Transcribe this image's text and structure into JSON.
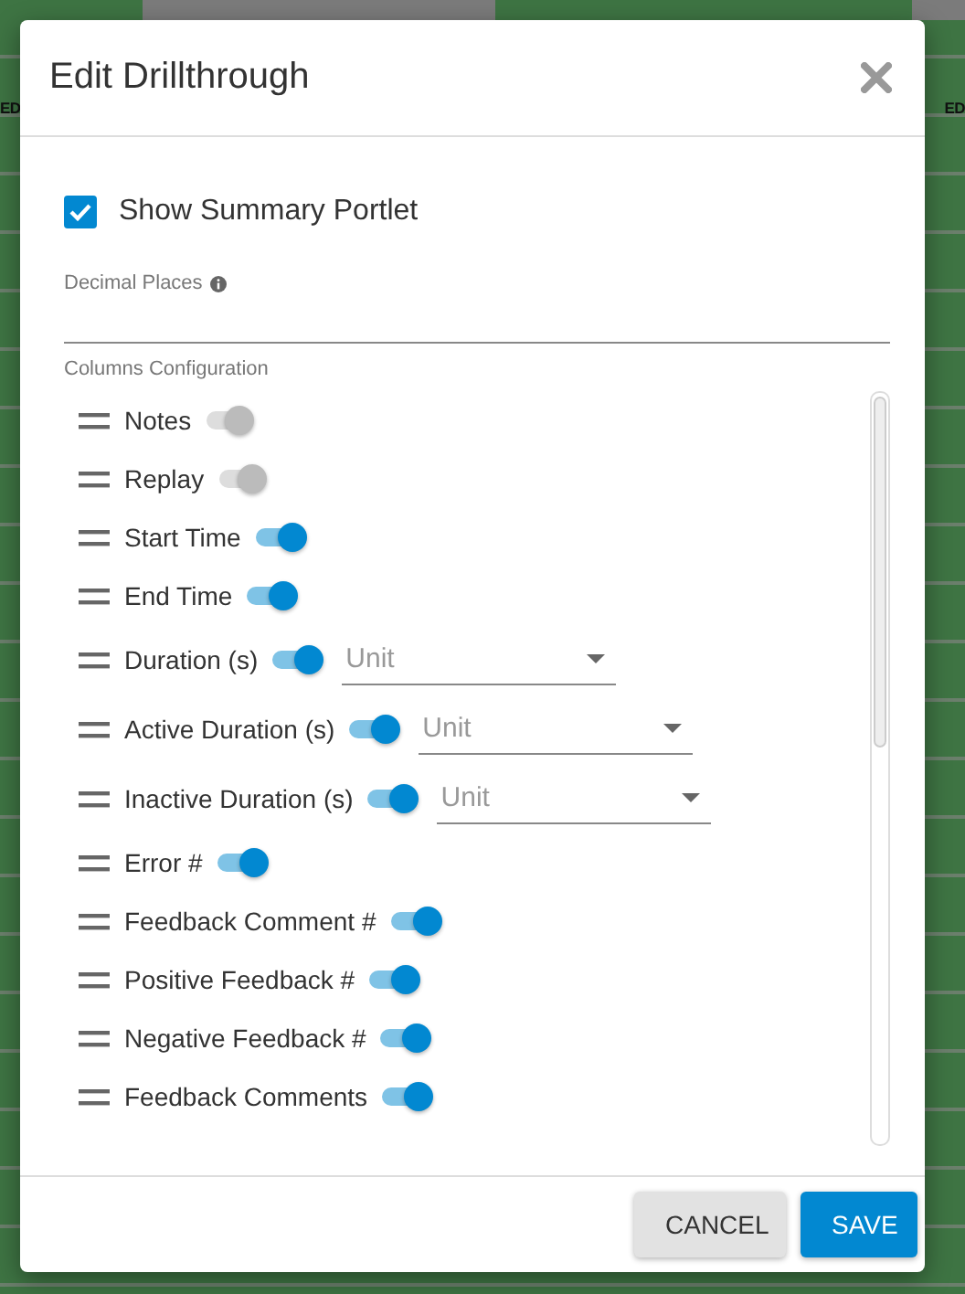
{
  "backdrop": {
    "edge_labels": [
      "ED",
      "ED"
    ]
  },
  "dialog": {
    "title": "Edit Drillthrough",
    "show_summary": {
      "label": "Show Summary Portlet",
      "checked": true
    },
    "decimal_places": {
      "label": "Decimal Places"
    },
    "columns_label": "Columns Configuration",
    "columns": [
      {
        "kind": "toggle",
        "label": "Notes",
        "on": false
      },
      {
        "kind": "toggle",
        "label": "Replay",
        "on": false
      },
      {
        "kind": "toggle",
        "label": "Start Time",
        "on": true
      },
      {
        "kind": "toggle",
        "label": "End Time",
        "on": true
      },
      {
        "kind": "unit",
        "label": "Duration (s)",
        "on": true,
        "placeholder": "Unit"
      },
      {
        "kind": "unit",
        "label": "Active Duration (s)",
        "on": true,
        "placeholder": "Unit"
      },
      {
        "kind": "unit",
        "label": "Inactive Duration (s)",
        "on": true,
        "placeholder": "Unit"
      },
      {
        "kind": "toggle",
        "label": "Error #",
        "on": true
      },
      {
        "kind": "toggle",
        "label": "Feedback Comment #",
        "on": true
      },
      {
        "kind": "toggle",
        "label": "Positive Feedback #",
        "on": true
      },
      {
        "kind": "toggle",
        "label": "Negative Feedback #",
        "on": true
      },
      {
        "kind": "toggle",
        "label": "Feedback Comments",
        "on": true
      }
    ],
    "buttons": [
      {
        "kind": "secondary",
        "label": "CANCEL"
      },
      {
        "kind": "primary",
        "label": "SAVE"
      }
    ]
  }
}
